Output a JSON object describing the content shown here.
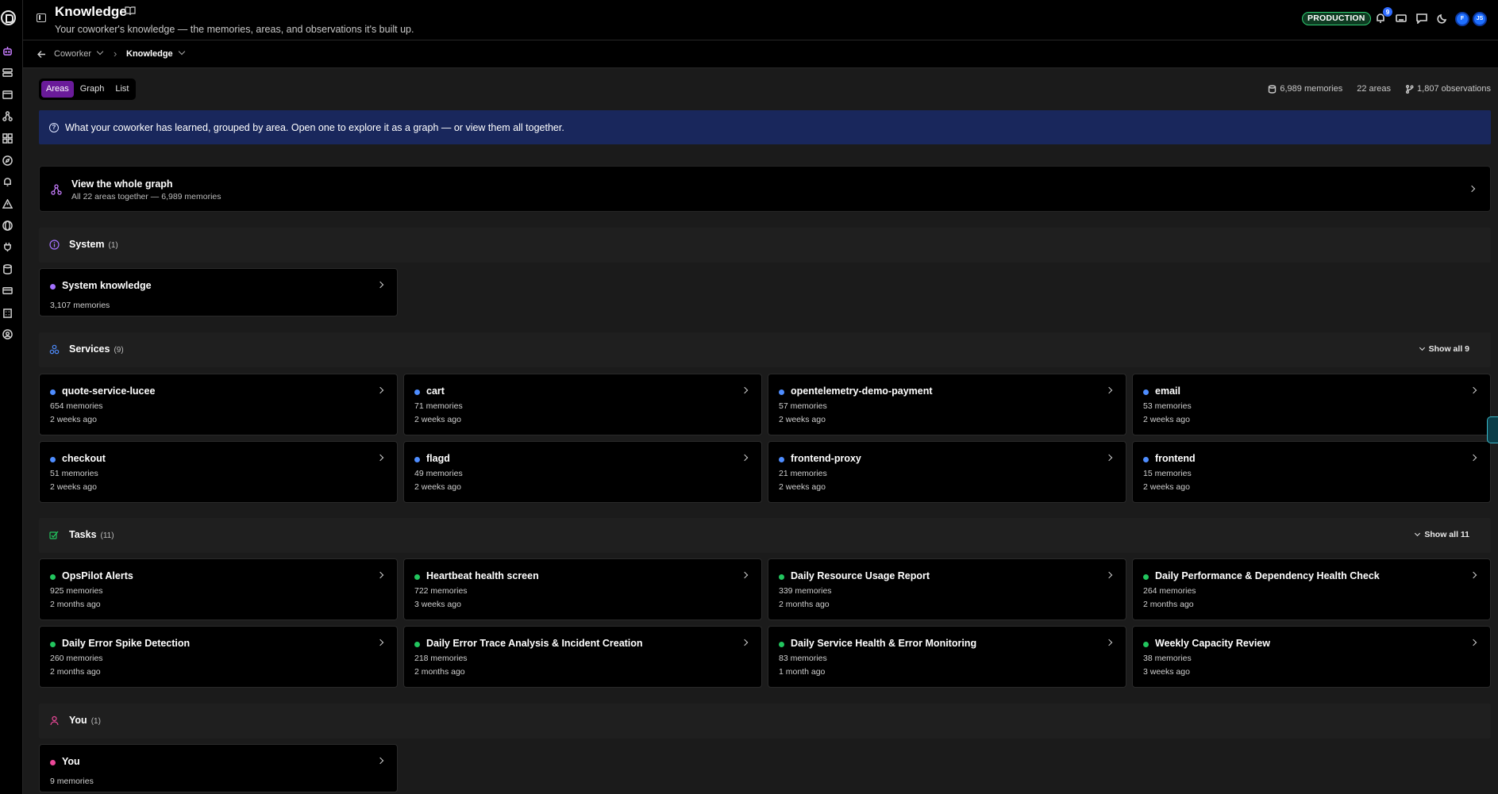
{
  "header": {
    "title": "Knowledge",
    "subtitle": "Your coworker's knowledge — the memories, areas, and observations it's built up.",
    "env_badge": "PRODUCTION",
    "notification_count": "9",
    "avatar_initials_1": "F",
    "avatar_initials_2": "JS"
  },
  "breadcrumb": {
    "items": [
      {
        "label": "Coworker"
      },
      {
        "label": "Knowledge"
      }
    ]
  },
  "view_toggle": {
    "options": [
      {
        "label": "Areas",
        "active": true
      },
      {
        "label": "Graph",
        "active": false
      },
      {
        "label": "List",
        "active": false
      }
    ]
  },
  "stats": {
    "memories": "6,989 memories",
    "areas": "22 areas",
    "observations": "1,807 observations"
  },
  "info_banner": {
    "text": "What your coworker has learned, grouped by area. Open one to explore it as a graph — or view them all together."
  },
  "whole_graph": {
    "title": "View the whole graph",
    "subtitle": "All 22 areas together — 6,989 memories"
  },
  "sections": [
    {
      "title": "System",
      "count": "(1)",
      "cards": [
        {
          "title": "System knowledge",
          "memories": "3,107 memories"
        }
      ]
    },
    {
      "title": "Services",
      "count": "(9)",
      "show_all": "Show all 9",
      "cards": [
        {
          "title": "quote-service-lucee",
          "memories": "654 memories",
          "time": "2 weeks ago"
        },
        {
          "title": "cart",
          "memories": "71 memories",
          "time": "2 weeks ago"
        },
        {
          "title": "opentelemetry-demo-payment",
          "memories": "57 memories",
          "time": "2 weeks ago"
        },
        {
          "title": "email",
          "memories": "53 memories",
          "time": "2 weeks ago"
        },
        {
          "title": "checkout",
          "memories": "51 memories",
          "time": "2 weeks ago"
        },
        {
          "title": "flagd",
          "memories": "49 memories",
          "time": "2 weeks ago"
        },
        {
          "title": "frontend-proxy",
          "memories": "21 memories",
          "time": "2 weeks ago"
        },
        {
          "title": "frontend",
          "memories": "15 memories",
          "time": "2 weeks ago"
        }
      ]
    },
    {
      "title": "Tasks",
      "count": "(11)",
      "show_all": "Show all 11",
      "cards": [
        {
          "title": "OpsPilot Alerts",
          "memories": "925 memories",
          "time": "2 months ago"
        },
        {
          "title": "Heartbeat health screen",
          "memories": "722 memories",
          "time": "3 weeks ago"
        },
        {
          "title": "Daily Resource Usage Report",
          "memories": "339 memories",
          "time": "2 months ago"
        },
        {
          "title": "Daily Performance & Dependency Health Check",
          "memories": "264 memories",
          "time": "2 months ago"
        },
        {
          "title": "Daily Error Spike Detection",
          "memories": "260 memories",
          "time": "2 months ago"
        },
        {
          "title": "Daily Error Trace Analysis & Incident Creation",
          "memories": "218 memories",
          "time": "2 months ago"
        },
        {
          "title": "Daily Service Health & Error Monitoring",
          "memories": "83 memories",
          "time": "1 month ago"
        },
        {
          "title": "Weekly Capacity Review",
          "memories": "38 memories",
          "time": "3 weeks ago"
        }
      ]
    },
    {
      "title": "You",
      "count": "(1)",
      "cards": [
        {
          "title": "You",
          "memories": "9 memories"
        }
      ]
    }
  ],
  "colors": {
    "system_dot": "#a472ff",
    "services_dot": "#4e8dff",
    "tasks_dot": "#22c55e",
    "you_dot": "#ec4899",
    "accent": "#6a1b9a",
    "banner": "#19275c"
  },
  "sidebar": {
    "icons": [
      "robot-icon",
      "server-icon",
      "window-icon",
      "topology-icon",
      "grid-icon",
      "compass-icon",
      "bell-icon",
      "alert-icon",
      "globe-icon",
      "plug-icon",
      "database-icon",
      "card-icon",
      "building-icon",
      "user-circle-icon"
    ]
  }
}
